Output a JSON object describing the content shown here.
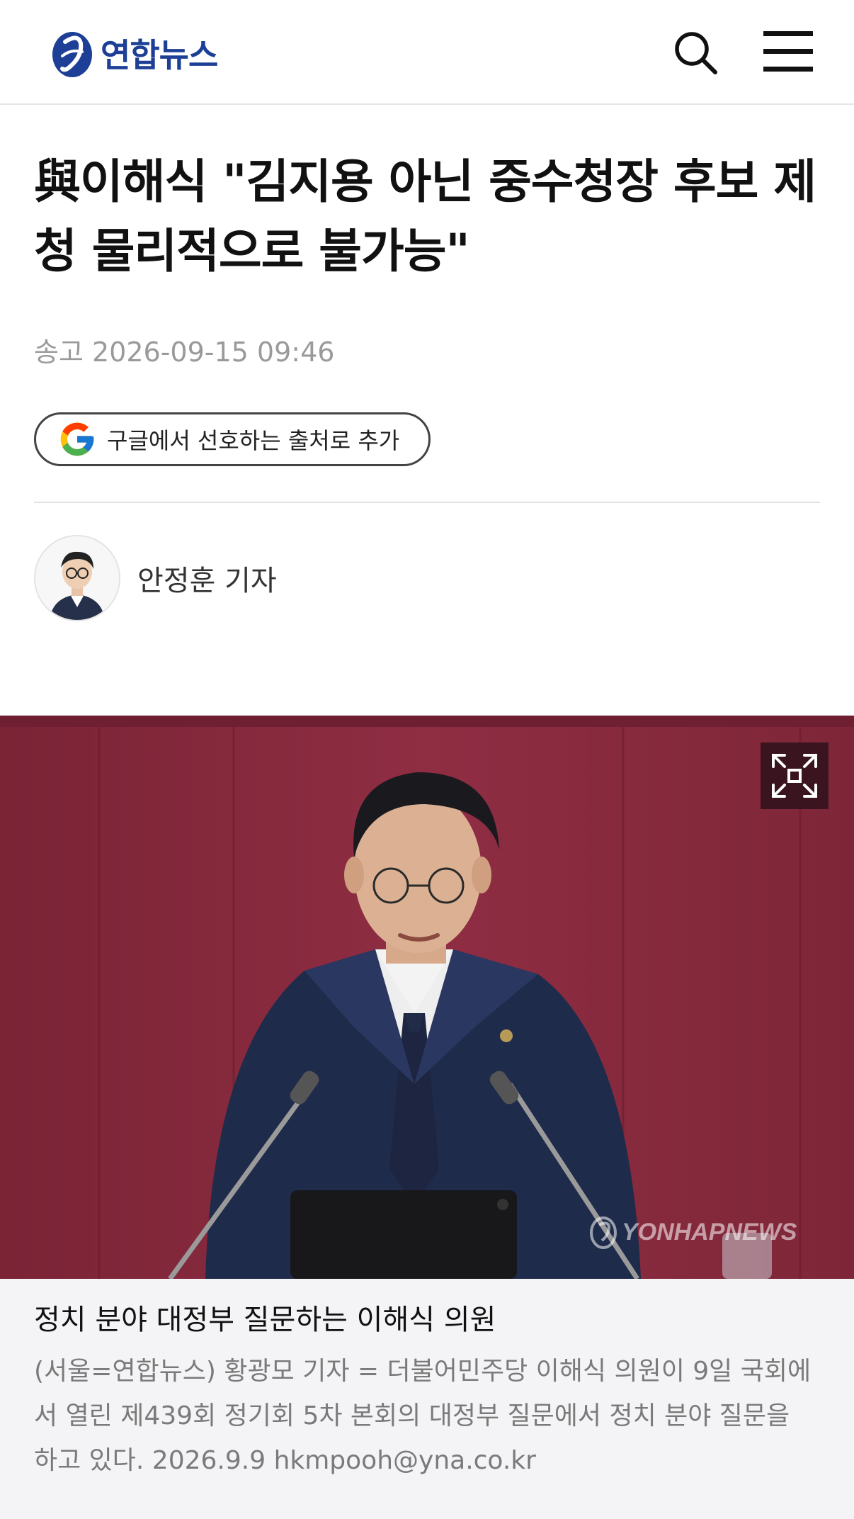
{
  "header": {
    "logo_text": "연합뉴스",
    "search_icon": "search-icon",
    "menu_icon": "hamburger-menu-icon",
    "brand_color": "#1d3f96"
  },
  "article": {
    "headline": "與이해식 \"김지용 아닌 중수청장 후보 제청 물리적으로 불가능\"",
    "date": "송고 2026-09-15 09:46",
    "google_button": "구글에서 선호하는 출처로 추가",
    "reporter_name": "안정훈 기자"
  },
  "photo": {
    "watermark": "YONHAPNEWS",
    "expand_icon": "expand-icon",
    "background_color": "#8a2a3e",
    "caption_title": "정치 분야 대정부 질문하는 이해식 의원",
    "caption_body": "(서울=연합뉴스) 황광모 기자 = 더불어민주당 이해식 의원이 9일 국회에서 열린 제439회 정기회 5차 본회의 대정부 질문에서 정치 분야 질문을 하고 있다. 2026.9.9 hkmpooh@yna.co.kr"
  }
}
